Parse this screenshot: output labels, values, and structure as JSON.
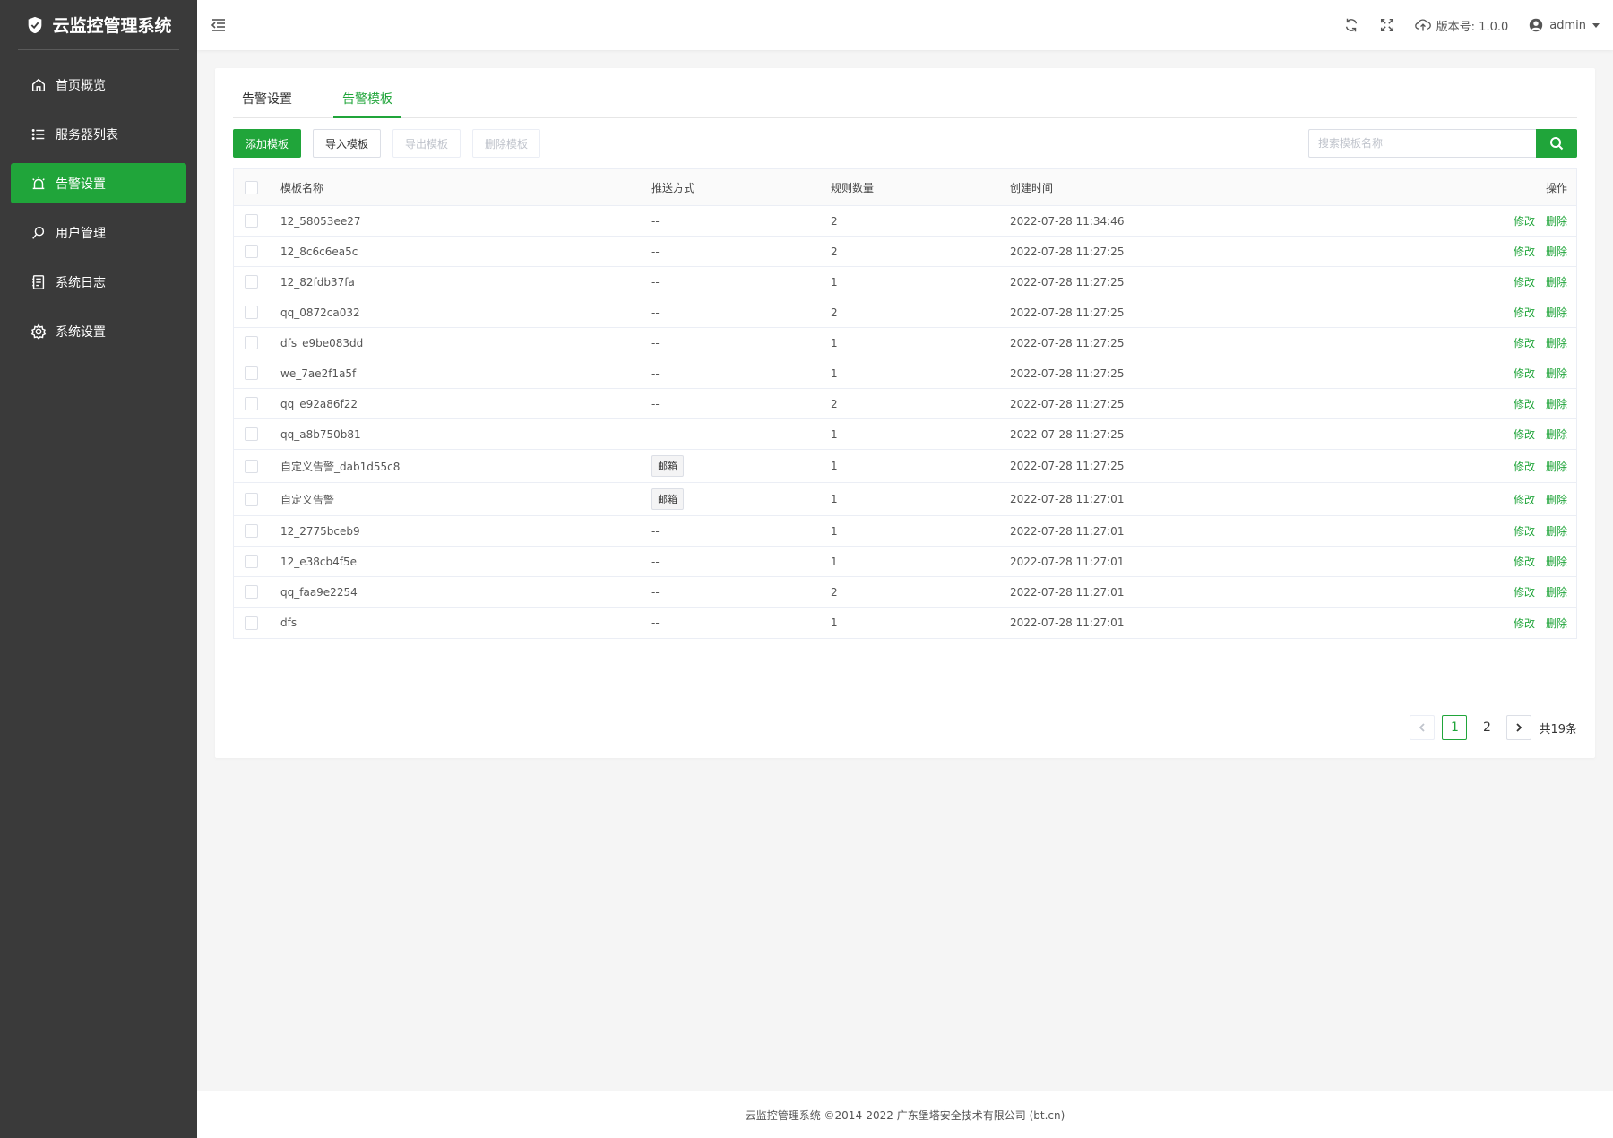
{
  "app": {
    "title": "云监控管理系统"
  },
  "sidebar": {
    "items": [
      {
        "label": "首页概览",
        "icon": "home-icon",
        "active": false
      },
      {
        "label": "服务器列表",
        "icon": "list-icon",
        "active": false
      },
      {
        "label": "告警设置",
        "icon": "alarm-icon",
        "active": true
      },
      {
        "label": "用户管理",
        "icon": "user-search-icon",
        "active": false
      },
      {
        "label": "系统日志",
        "icon": "log-icon",
        "active": false
      },
      {
        "label": "系统设置",
        "icon": "gear-icon",
        "active": false
      }
    ]
  },
  "header": {
    "version": "版本号: 1.0.0",
    "user": "admin"
  },
  "tabs": [
    {
      "label": "告警设置",
      "active": false
    },
    {
      "label": "告警模板",
      "active": true
    }
  ],
  "toolbar": {
    "add": "添加模板",
    "import": "导入模板",
    "export": "导出模板",
    "delete": "删除模板",
    "search_placeholder": "搜索模板名称"
  },
  "table": {
    "columns": {
      "name": "模板名称",
      "push": "推送方式",
      "count": "规则数量",
      "time": "创建时间",
      "op": "操作"
    },
    "edit_label": "修改",
    "delete_label": "删除",
    "rows": [
      {
        "name": "12_58053ee27",
        "push": "--",
        "count": "2",
        "time": "2022-07-28 11:34:46",
        "tag": false
      },
      {
        "name": "12_8c6c6ea5c",
        "push": "--",
        "count": "2",
        "time": "2022-07-28 11:27:25",
        "tag": false
      },
      {
        "name": "12_82fdb37fa",
        "push": "--",
        "count": "1",
        "time": "2022-07-28 11:27:25",
        "tag": false
      },
      {
        "name": "qq_0872ca032",
        "push": "--",
        "count": "2",
        "time": "2022-07-28 11:27:25",
        "tag": false
      },
      {
        "name": "dfs_e9be083dd",
        "push": "--",
        "count": "1",
        "time": "2022-07-28 11:27:25",
        "tag": false
      },
      {
        "name": "we_7ae2f1a5f",
        "push": "--",
        "count": "1",
        "time": "2022-07-28 11:27:25",
        "tag": false
      },
      {
        "name": "qq_e92a86f22",
        "push": "--",
        "count": "2",
        "time": "2022-07-28 11:27:25",
        "tag": false
      },
      {
        "name": "qq_a8b750b81",
        "push": "--",
        "count": "1",
        "time": "2022-07-28 11:27:25",
        "tag": false
      },
      {
        "name": "自定义告警_dab1d55c8",
        "push": "邮箱",
        "count": "1",
        "time": "2022-07-28 11:27:25",
        "tag": true
      },
      {
        "name": "自定义告警",
        "push": "邮箱",
        "count": "1",
        "time": "2022-07-28 11:27:01",
        "tag": true
      },
      {
        "name": "12_2775bceb9",
        "push": "--",
        "count": "1",
        "time": "2022-07-28 11:27:01",
        "tag": false
      },
      {
        "name": "12_e38cb4f5e",
        "push": "--",
        "count": "1",
        "time": "2022-07-28 11:27:01",
        "tag": false
      },
      {
        "name": "qq_faa9e2254",
        "push": "--",
        "count": "2",
        "time": "2022-07-28 11:27:01",
        "tag": false
      },
      {
        "name": "dfs",
        "push": "--",
        "count": "1",
        "time": "2022-07-28 11:27:01",
        "tag": false
      }
    ]
  },
  "pagination": {
    "pages": [
      "1",
      "2"
    ],
    "current": "1",
    "total": "共19条"
  },
  "footer": {
    "text": "云监控管理系统 ©2014-2022 广东堡塔安全技术有限公司 (bt.cn)"
  },
  "colors": {
    "accent": "#20a53a",
    "sidebar": "#3a3a3a"
  }
}
